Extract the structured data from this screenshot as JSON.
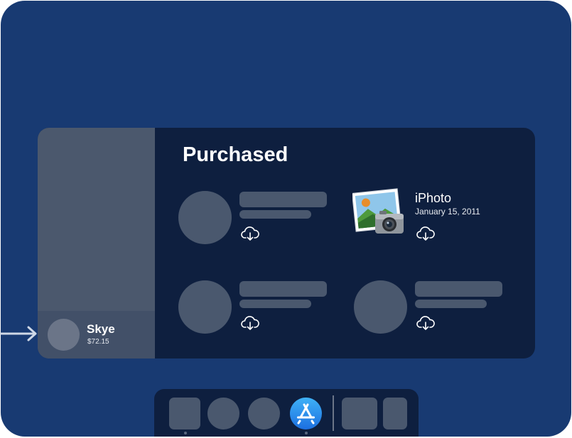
{
  "section": {
    "title": "Purchased"
  },
  "account": {
    "name": "Skye",
    "balance": "$72.15"
  },
  "purchases": [
    {
      "state": "placeholder",
      "icon": "cloud-download-icon"
    },
    {
      "state": "loaded",
      "name": "iPhoto",
      "date": "January 15, 2011",
      "app_icon": "iphoto-icon",
      "icon": "cloud-download-icon"
    },
    {
      "state": "placeholder",
      "icon": "cloud-download-icon"
    },
    {
      "state": "placeholder",
      "icon": "cloud-download-icon"
    }
  ],
  "dock": {
    "items": [
      "app-placeholder",
      "app-placeholder",
      "app-placeholder",
      "app-store-icon",
      "app-placeholder",
      "app-placeholder"
    ],
    "active": "app-store-icon"
  },
  "colors": {
    "desktop": "#183a72",
    "window": "#0e1f3f",
    "sidebar": "#4b586d",
    "placeholder": "#4a586e",
    "accent": "#2f8ff0"
  }
}
